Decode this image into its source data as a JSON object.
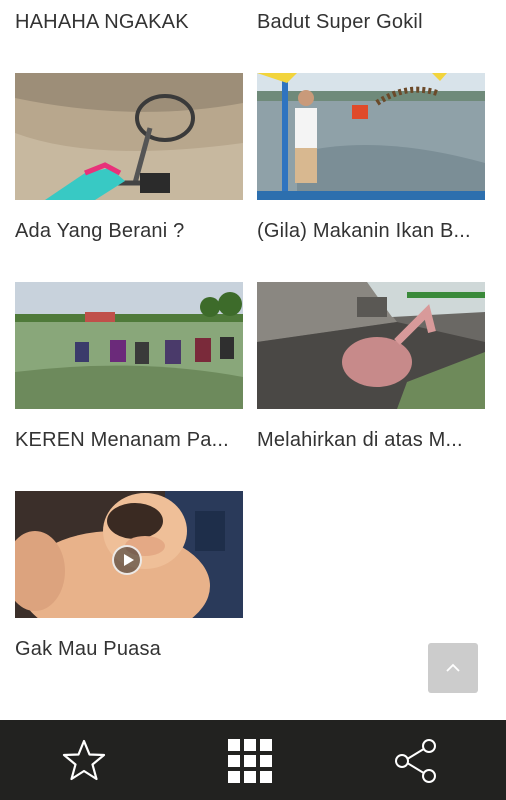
{
  "videos": [
    {
      "title": "HAHAHA NGAKAK"
    },
    {
      "title": "Badut Super Gokil"
    },
    {
      "title": "Ada Yang Berani ?"
    },
    {
      "title": "(Gila) Makanin Ikan B..."
    },
    {
      "title": "KEREN Menanam Pa..."
    },
    {
      "title": "Melahirkan di atas M..."
    },
    {
      "title": "Gak Mau Puasa"
    }
  ],
  "icons": {
    "play": "play-icon",
    "scroll_top": "chevron-up-icon",
    "favorite": "star-icon",
    "grid": "grid-icon",
    "share": "share-icon"
  },
  "colors": {
    "bottom_bar": "#222220",
    "scroll_top_button": "#cccccc",
    "title_text": "#333333"
  }
}
